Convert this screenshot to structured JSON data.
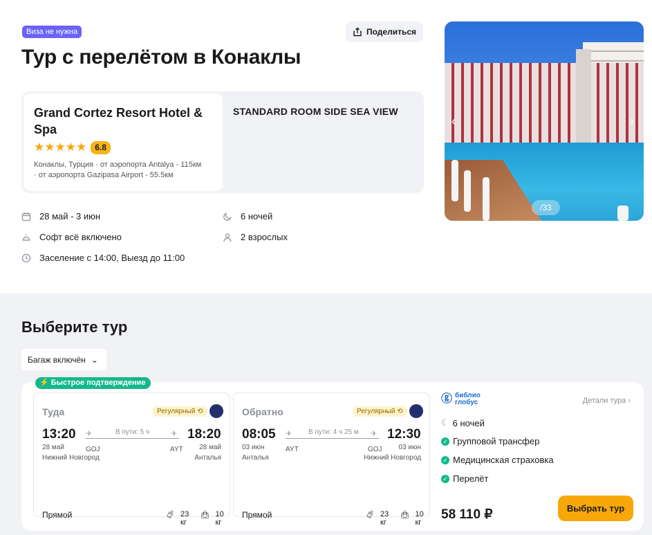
{
  "header": {
    "visa_badge": "Виза не нужна",
    "share_label": "Поделиться",
    "title": "Тур с перелётом в Конаклы"
  },
  "hotel": {
    "name": "Grand Cortez Resort Hotel & Spa",
    "stars": 5,
    "stars_glyphs": "★★★★★",
    "rating": "6.8",
    "location_line1": "Конаклы, Турция · от аэропорта Antalya - 115км",
    "location_line2": "· от аэропорта Gazipasa Airport - 55.5км",
    "room": "STANDARD ROOM SIDE SEA VIEW"
  },
  "info": {
    "dates": "28 май - 3 июн",
    "nights": "6 ночей",
    "meal": "Софт всё включено",
    "guests": "2 взрослых",
    "checkin": "Заселение с 14:00, Выезд до 11:00"
  },
  "photo": {
    "counter": "/33"
  },
  "tours": {
    "title": "Выберите тур",
    "filter_label": "Багаж включён",
    "fast_badge": "Быстрое подтверждение"
  },
  "offer": {
    "outbound": {
      "direction": "Туда",
      "regular": "Регулярный",
      "dep_time": "13:20",
      "arr_time": "18:20",
      "duration": "В пути: 5 ч",
      "dep_date": "28 май",
      "arr_date": "28 май",
      "dep_code": "GOJ",
      "arr_code": "AYT",
      "dep_city": "Нижний Новгород",
      "arr_city": "Анталья",
      "type": "Прямой",
      "bag": "23 кг",
      "hand": "10 кг"
    },
    "inbound": {
      "direction": "Обратно",
      "regular": "Регулярный",
      "dep_time": "08:05",
      "arr_time": "12:30",
      "duration": "В пути: 4 ч 25 м",
      "dep_date": "03 июн",
      "arr_date": "03 июн",
      "dep_code": "AYT",
      "arr_code": "GOJ",
      "dep_city": "Анталья",
      "arr_city": "Нижний Новгород",
      "type": "Прямой",
      "bag": "23 кг",
      "hand": "10 кг"
    },
    "summary": {
      "logo_line1": "библио",
      "logo_line2": "глобус",
      "details_link": "Детали тура",
      "nights": "6 ночей",
      "features": [
        "Групповой трансфер",
        "Медицинская страховка",
        "Перелёт"
      ],
      "price": "58 110 ₽",
      "choose_label": "Выбрать тур"
    }
  },
  "colors": {
    "accent_orange": "#f7a70a",
    "green": "#14b88b",
    "visa_purple": "#6b63f5",
    "panel_gray": "#f1f2f6"
  }
}
